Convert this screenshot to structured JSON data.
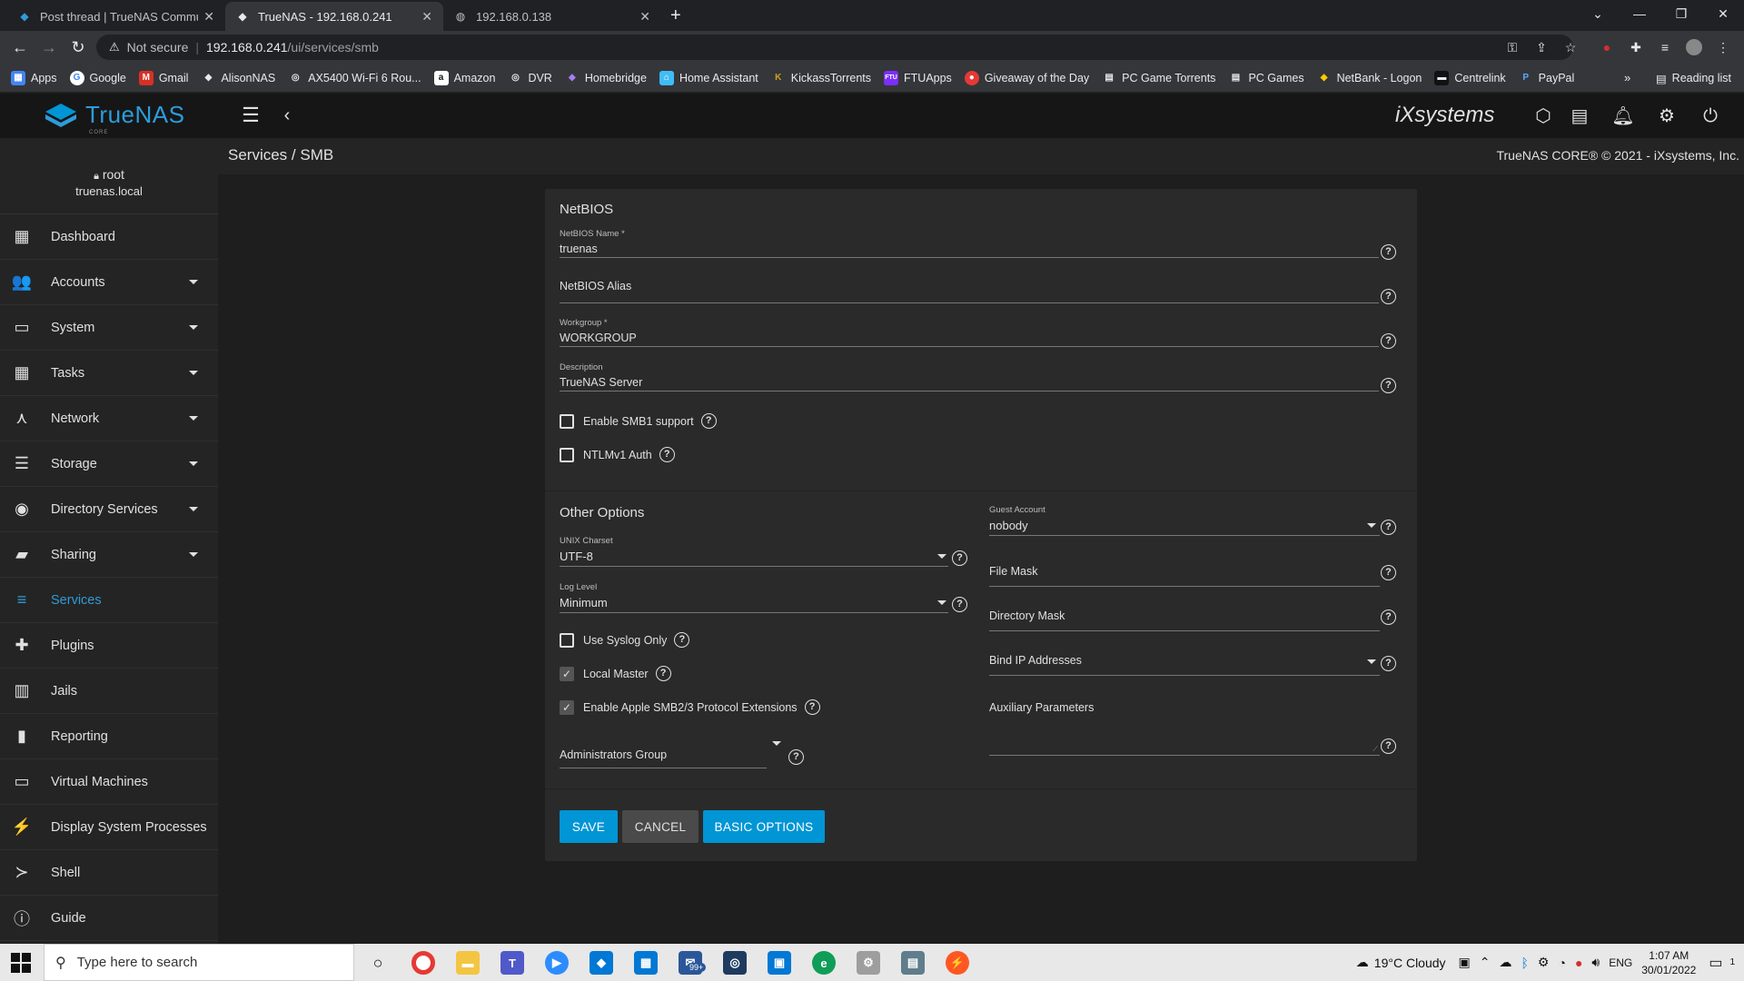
{
  "browser": {
    "tabs": [
      {
        "title": "Post thread | TrueNAS Communi",
        "active": false
      },
      {
        "title": "TrueNAS - 192.168.0.241",
        "active": true
      },
      {
        "title": "192.168.0.138",
        "active": false
      }
    ],
    "address": {
      "security": "Not secure",
      "host": "192.168.0.241",
      "path": "/ui/services/smb"
    },
    "bookmarks": [
      {
        "label": "Apps",
        "color": "#4285f4",
        "glyph": "▦"
      },
      {
        "label": "Google",
        "color": "#ffffff",
        "glyph": "G"
      },
      {
        "label": "Gmail",
        "color": "#d93025",
        "glyph": "M"
      },
      {
        "label": "AlisonNAS",
        "color": "#2d9cdb",
        "glyph": "◆"
      },
      {
        "label": "AX5400 Wi-Fi 6 Rou...",
        "color": "#555555",
        "glyph": "◎"
      },
      {
        "label": "Amazon",
        "color": "#ffffff",
        "glyph": "a"
      },
      {
        "label": "DVR",
        "color": "#555555",
        "glyph": "◎"
      },
      {
        "label": "Homebridge",
        "color": "#6b4fbb",
        "glyph": "◆"
      },
      {
        "label": "Home Assistant",
        "color": "#41bdf5",
        "glyph": "⌂"
      },
      {
        "label": "KickassTorrents",
        "color": "#d4a017",
        "glyph": "K"
      },
      {
        "label": "FTUApps",
        "color": "#7b2ff7",
        "glyph": "F"
      },
      {
        "label": "Giveaway of the Day",
        "color": "#e53935",
        "glyph": "●"
      },
      {
        "label": "PC Game Torrents",
        "color": "#555555",
        "glyph": "▤"
      },
      {
        "label": "PC Games",
        "color": "#555555",
        "glyph": "▤"
      },
      {
        "label": "NetBank - Logon",
        "color": "#ffcc00",
        "glyph": "◆"
      },
      {
        "label": "Centrelink",
        "color": "#333333",
        "glyph": "▬"
      },
      {
        "label": "PayPal",
        "color": "#003087",
        "glyph": "P"
      }
    ],
    "reading_list": "Reading list"
  },
  "app": {
    "brand": "TrueNAS",
    "edition": "CORE",
    "vendor": "iXsystems",
    "breadcrumb": "Services  /  SMB",
    "copyright": "TrueNAS CORE® © 2021 - iXsystems, Inc."
  },
  "user": {
    "name": "root",
    "host": "truenas.local"
  },
  "nav": [
    {
      "label": "Dashboard",
      "icon": "dashboard-icon",
      "glyph": "▦",
      "expandable": false,
      "active": false
    },
    {
      "label": "Accounts",
      "icon": "people-icon",
      "glyph": "👥",
      "expandable": true,
      "active": false
    },
    {
      "label": "System",
      "icon": "laptop-icon",
      "glyph": "▭",
      "expandable": true,
      "active": false
    },
    {
      "label": "Tasks",
      "icon": "calendar-icon",
      "glyph": "▦",
      "expandable": true,
      "active": false
    },
    {
      "label": "Network",
      "icon": "network-icon",
      "glyph": "⋏",
      "expandable": true,
      "active": false
    },
    {
      "label": "Storage",
      "icon": "storage-icon",
      "glyph": "☰",
      "expandable": true,
      "active": false
    },
    {
      "label": "Directory Services",
      "icon": "directory-icon",
      "glyph": "◉",
      "expandable": true,
      "active": false
    },
    {
      "label": "Sharing",
      "icon": "folder-share-icon",
      "glyph": "▰",
      "expandable": true,
      "active": false
    },
    {
      "label": "Services",
      "icon": "tune-icon",
      "glyph": "≡",
      "expandable": false,
      "active": true
    },
    {
      "label": "Plugins",
      "icon": "puzzle-icon",
      "glyph": "✚",
      "expandable": false,
      "active": false
    },
    {
      "label": "Jails",
      "icon": "jail-icon",
      "glyph": "▥",
      "expandable": false,
      "active": false
    },
    {
      "label": "Reporting",
      "icon": "chart-icon",
      "glyph": "▮",
      "expandable": false,
      "active": false
    },
    {
      "label": "Virtual Machines",
      "icon": "laptop-icon",
      "glyph": "▭",
      "expandable": false,
      "active": false
    },
    {
      "label": "Display System Processes",
      "icon": "pulse-icon",
      "glyph": "⚡",
      "expandable": false,
      "active": false
    },
    {
      "label": "Shell",
      "icon": "console-icon",
      "glyph": "≻",
      "expandable": false,
      "active": false
    },
    {
      "label": "Guide",
      "icon": "info-icon",
      "glyph": "ⓘ",
      "expandable": false,
      "active": false
    }
  ],
  "form": {
    "netbios_title": "NetBIOS",
    "netbios_name": {
      "label": "NetBIOS Name *",
      "value": "truenas"
    },
    "netbios_alias": {
      "placeholder": "NetBIOS Alias"
    },
    "workgroup": {
      "label": "Workgroup *",
      "value": "WORKGROUP"
    },
    "description": {
      "label": "Description",
      "value": "TrueNAS Server"
    },
    "smb1": {
      "label": "Enable SMB1 support",
      "checked": false
    },
    "ntlmv1": {
      "label": "NTLMv1 Auth",
      "checked": false
    },
    "other_title": "Other Options",
    "unix_charset": {
      "label": "UNIX Charset",
      "value": "UTF-8"
    },
    "log_level": {
      "label": "Log Level",
      "value": "Minimum"
    },
    "syslog_only": {
      "label": "Use Syslog Only",
      "checked": false
    },
    "local_master": {
      "label": "Local Master",
      "checked": true
    },
    "apple_ext": {
      "label": "Enable Apple SMB2/3 Protocol Extensions",
      "checked": true
    },
    "admin_group": {
      "placeholder": "Administrators Group"
    },
    "guest_account": {
      "label": "Guest Account",
      "value": "nobody"
    },
    "file_mask": {
      "placeholder": "File Mask"
    },
    "directory_mask": {
      "placeholder": "Directory Mask"
    },
    "bind_ip": {
      "placeholder": "Bind IP Addresses"
    },
    "aux_params": {
      "placeholder": "Auxiliary Parameters"
    },
    "buttons": {
      "save": "SAVE",
      "cancel": "CANCEL",
      "basic": "BASIC OPTIONS"
    }
  },
  "taskbar": {
    "search_placeholder": "Type here to search",
    "mail_badge": "99+",
    "weather": "19°C  Cloudy",
    "lang": "ENG",
    "time": "1:07 AM",
    "date": "30/01/2022",
    "notification_count": "1"
  }
}
